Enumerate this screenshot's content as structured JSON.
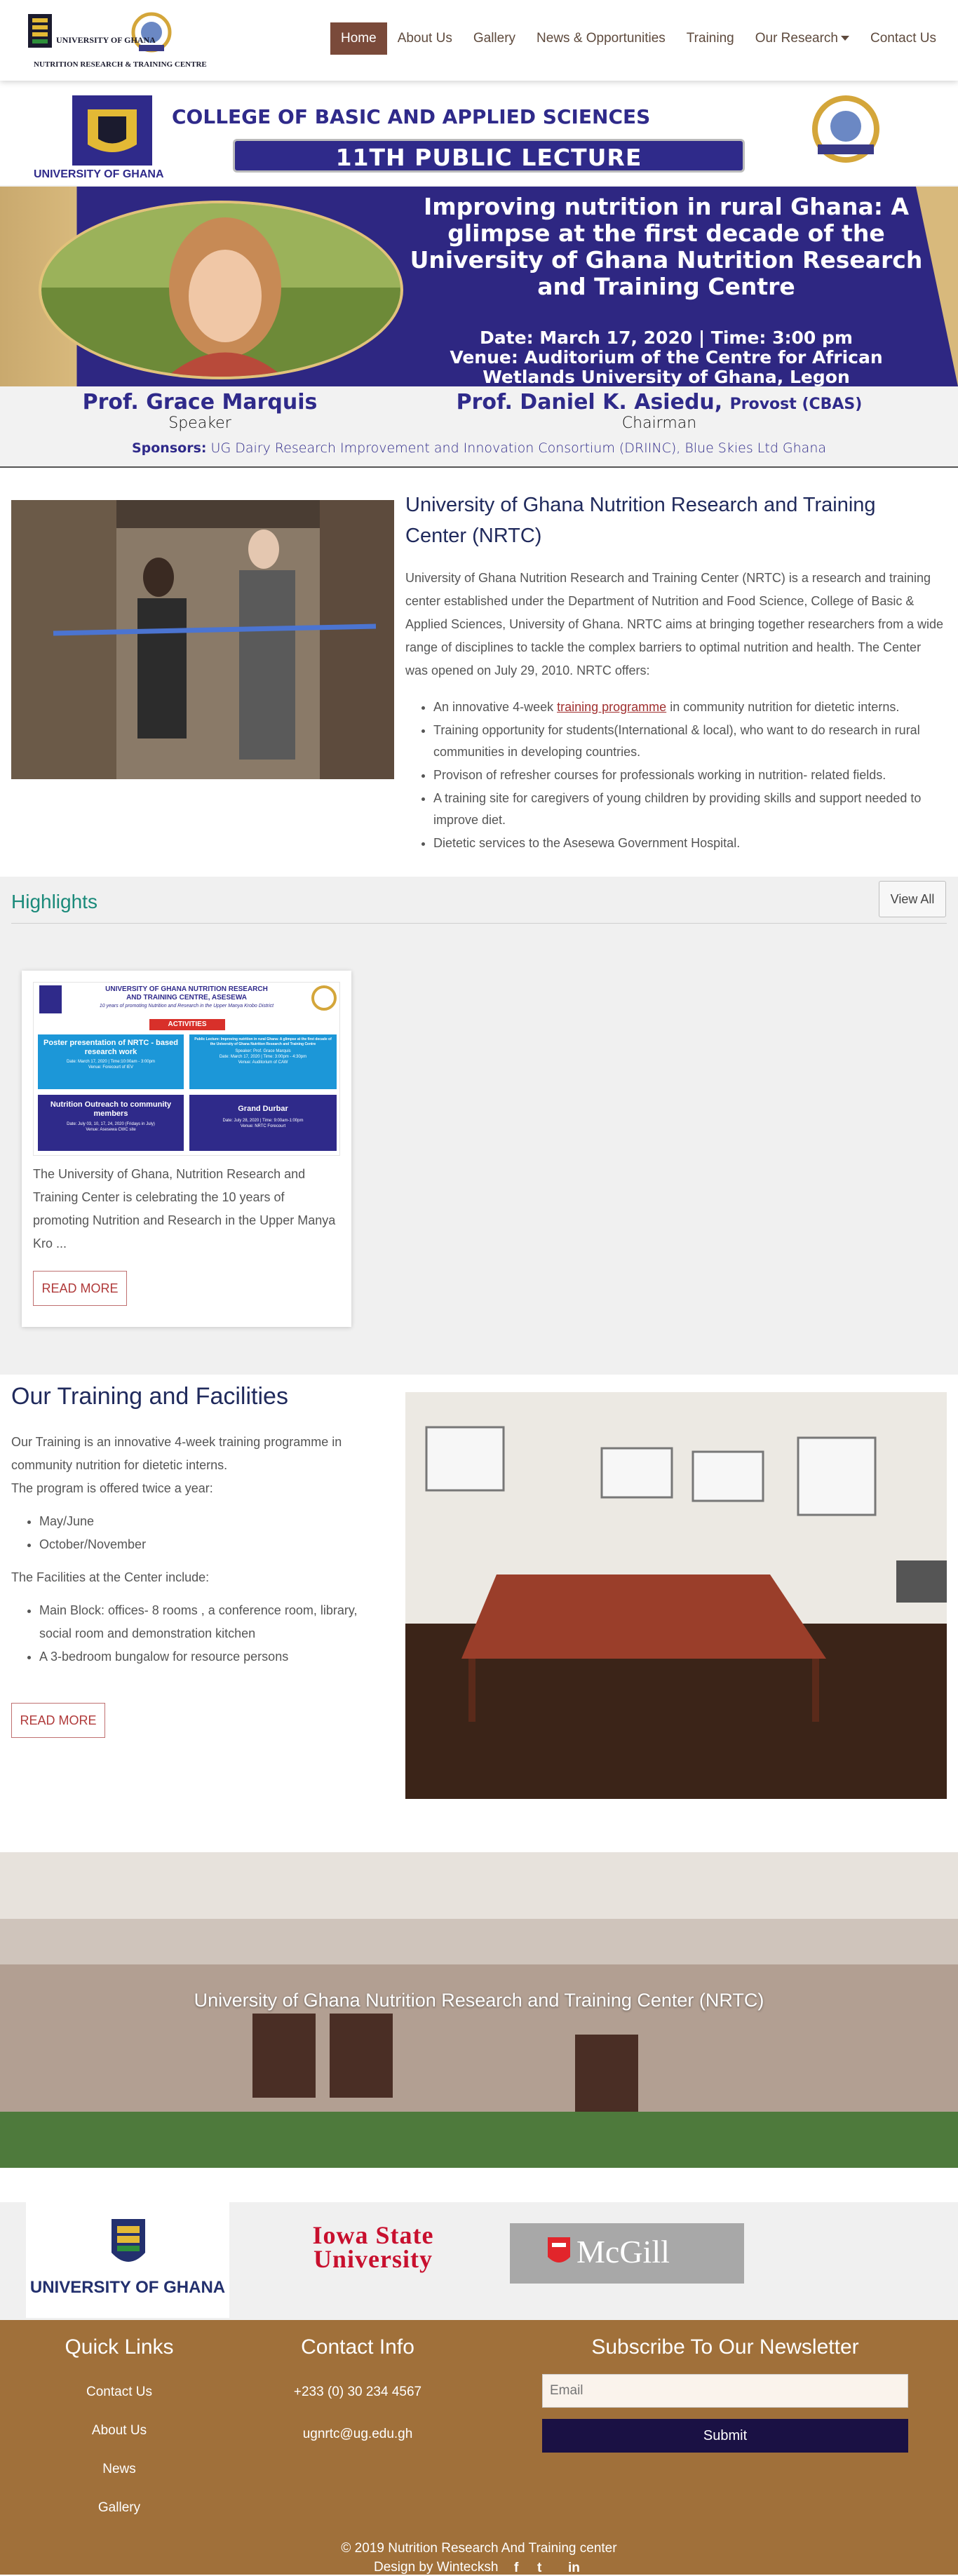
{
  "header": {
    "logo_line1": "UNIVERSITY OF GHANA",
    "logo_line2": "NUTRITION RESEARCH & TRAINING CENTRE",
    "nav": [
      {
        "label": "Home"
      },
      {
        "label": "About Us"
      },
      {
        "label": "Gallery"
      },
      {
        "label": "News & Opportunities"
      },
      {
        "label": "Training"
      },
      {
        "label": "Our Research"
      },
      {
        "label": "Contact Us"
      }
    ]
  },
  "banner": {
    "college": "COLLEGE OF BASIC AND APPLIED SCIENCES",
    "lecture": "11TH PUBLIC LECTURE",
    "university": "UNIVERSITY OF GHANA",
    "headline": "Improving nutrition in rural Ghana: A glimpse at the first decade of the University of Ghana Nutrition Research and Training Centre",
    "date_time": "Date: March 17, 2020 | Time: 3:00 pm",
    "venue": "Venue: Auditorium of the Centre for African Wetlands University of Ghana, Legon",
    "speaker_name": "Prof. Grace Marquis",
    "speaker_role": "Speaker",
    "chair_name": "Prof. Daniel K. Asiedu,",
    "chair_provost": "Provost (CBAS)",
    "chair_role": "Chairman",
    "sponsors_label": "Sponsors:",
    "sponsors": "UG Dairy Research Improvement and Innovation Consortium (DRIINC), Blue Skies Ltd Ghana"
  },
  "about": {
    "title": "University of Ghana Nutrition Research and Training Center (NRTC)",
    "text": "University of Ghana Nutrition Research and Training Center (NRTC) is a research and training center established under the Department of Nutrition and Food Science, College of Basic & Applied Sciences, University of Ghana. NRTC aims at bringing together researchers from a wide range of disciplines to tackle the complex barriers to optimal nutrition and health. The Center was opened on July 29, 2010. NRTC offers:",
    "item1_pre": "An innovative 4-week ",
    "item1_link": "training programme",
    "item1_post": " in community nutrition for dietetic interns.",
    "item2": "Training opportunity for students(International & local), who want to do research in rural communities in developing countries.",
    "item3": "Provison of refresher courses for professionals working in nutrition- related fields.",
    "item4": "A training site for caregivers of young children by providing skills and support needed to improve diet.",
    "item5": "Dietetic services to the Asesewa Government Hospital."
  },
  "highlights": {
    "title": "Highlights",
    "view_all": "View All",
    "poster": {
      "title1": "UNIVERSITY OF GHANA NUTRITION RESEARCH",
      "title2": "AND TRAINING CENTRE, ASESEWA",
      "sub": "10 years of promoting Nutrition and Research in the Upper Manya Krobo District",
      "activities": "ACTIVITIES",
      "b1_title": "Poster presentation of NRTC - based research work",
      "b1_date": "Date: March 17, 2020 | Time:10:00am - 3:00pm",
      "b1_venue": "Venue: Forecourt of IEV",
      "b2_title": "Public Lecture: Improving nutrition in rural Ghana: A glimpse at the first decade of the University of Ghana Nutrition Research and Training Centre",
      "b2_speaker": "Speaker: Prof. Grace Marquis",
      "b2_date": "Date: March 17, 2020 | Time: 3:00pm - 4:30pm",
      "b2_venue": "Venue: Auditorium of CAW",
      "b3_title": "Nutrition Outreach to community members",
      "b3_date": "Date: July 03, 10, 17, 24, 2020 (Fridays in July)",
      "b3_venue": "Venue: Asesewa CWC site",
      "b4_title": "Grand Durbar",
      "b4_date": "Date: July 28, 2020 | Time: 9:00am-1:00pm",
      "b4_venue": "Venue: NRTC Forecourt"
    },
    "card_text": "The University of Ghana, Nutrition Research and Training Center is celebrating the 10 years of promoting Nutrition and Research in the Upper Manya Kro ...",
    "read_more": "READ MORE"
  },
  "training": {
    "title": "Our Training and Facilities",
    "intro": "Our Training is an innovative 4-week training programme in community nutrition for dietetic interns.",
    "offered": "The program is offered twice a year:",
    "periods": [
      "May/June",
      "October/November"
    ],
    "facilities_intro": "The Facilities at the Center include:",
    "facilities": [
      "Main Block: offices- 8 rooms , a conference room, library, social room and demonstration kitchen",
      "A 3-bedroom bungalow for resource persons"
    ],
    "read_more": "READ MORE"
  },
  "parallax": {
    "caption": "University of Ghana Nutrition Research and Training Center (NRTC)"
  },
  "partners": {
    "uog": "UNIVERSITY OF GHANA",
    "isu_line1": "Iowa State",
    "isu_line2": "University",
    "mcgill": "McGill"
  },
  "footer": {
    "quick_links_title": "Quick Links",
    "quick_links": [
      "Contact Us",
      "About Us",
      "News",
      "Gallery"
    ],
    "contact_title": "Contact Info",
    "phone": "+233 (0) 30 234 4567",
    "email": "ugnrtc@ug.edu.gh",
    "newsletter_title": "Subscribe To Our Newsletter",
    "email_placeholder": "Email",
    "submit": "Submit",
    "copyright": "© 2019 Nutrition Research And Training center",
    "design": "Design by Wintecksh",
    "social": [
      "f",
      "t",
      "in"
    ]
  },
  "colors": {
    "nav_active": "#7a4a3a",
    "banner_purple": "#2e2782",
    "highlight_title": "#1a8a7a",
    "heading_navy": "#202a5c",
    "footer_bg": "#a0703a",
    "submit_bg": "#1a1144",
    "read_more": "#b03a3a"
  }
}
